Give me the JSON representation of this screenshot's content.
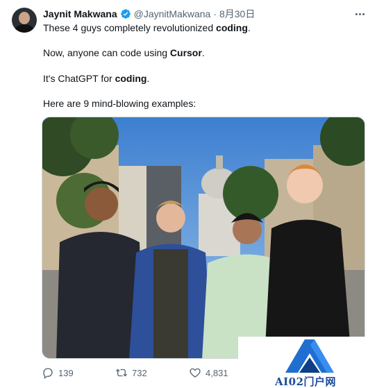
{
  "author": {
    "name": "Jaynit Makwana",
    "handle": "@JaynitMakwana",
    "separator": "·",
    "date": "8月30日"
  },
  "body": {
    "line1": {
      "before": "These 4 guys completely revolutionized ",
      "bold": "coding",
      "after": "."
    },
    "line2": {
      "before": "Now, anyone can code using ",
      "bold": "Cursor",
      "after": "."
    },
    "line3": {
      "before": "It's ChatGPT for ",
      "bold": "coding",
      "after": "."
    },
    "line4": {
      "before": "Here are 9 mind-blowing examples:",
      "bold": "",
      "after": ""
    }
  },
  "actions": {
    "replies": "139",
    "retweets": "732",
    "likes": "4,831"
  },
  "watermark": {
    "text": "AI02门户网"
  },
  "icons": {
    "verified": "verified-badge-icon",
    "more": "more-horizontal-icon",
    "reply": "reply-icon",
    "retweet": "retweet-icon",
    "like": "heart-icon",
    "logo": "a-logo-icon"
  },
  "colors": {
    "verified_blue": "#1d9bf0",
    "text_primary": "#0f1419",
    "text_secondary": "#536471",
    "watermark_blue": "#1a4a9a"
  }
}
